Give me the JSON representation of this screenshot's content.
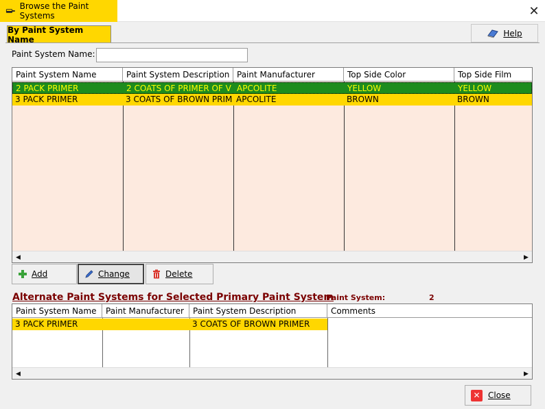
{
  "window": {
    "title": "Browse the Paint Systems",
    "close_glyph": "✕"
  },
  "tab": {
    "label": "By Paint System Name"
  },
  "help": {
    "label": "Help"
  },
  "search": {
    "label": "Paint System Name:",
    "value": "",
    "placeholder": ""
  },
  "main_grid": {
    "columns": [
      "Paint System Name",
      "Paint System Description",
      "Paint Manufacturer",
      "Top Side Color",
      "Top Side Film"
    ],
    "rows": [
      [
        "2 PACK PRIMER",
        "2 COATS OF PRIMER OF V",
        "APCOLITE",
        "YELLOW",
        "YELLOW"
      ],
      [
        "3 PACK PRIMER",
        "3 COATS OF BROWN PRIM",
        "APCOLITE",
        "BROWN",
        "BROWN"
      ]
    ],
    "selected_row": 0
  },
  "actions": {
    "add": "Add",
    "change": "Change",
    "delete": "Delete"
  },
  "alternate": {
    "title": "Alternate Paint Systems for Selected Primary Paint System",
    "ps_label": "Paint System:",
    "ps_value": "2",
    "columns": [
      "Paint System Name",
      "Paint Manufacturer",
      "Paint System Description",
      "Comments"
    ],
    "rows": [
      [
        "3 PACK PRIMER",
        "",
        "3 COATS OF BROWN PRIMER",
        ""
      ]
    ]
  },
  "close_button": {
    "label": "Close"
  },
  "colors": {
    "accent_yellow": "#ffd700",
    "selected_green": "#1e8c1e",
    "selected_text": "#ffff00",
    "grid_bg": "#fdeadf",
    "alt_title": "#7a0000"
  },
  "icons": {
    "app": "paint-brush-icon",
    "help": "book-icon",
    "add": "plus-icon",
    "change": "pencil-icon",
    "delete": "trash-icon",
    "close": "red-x-icon"
  }
}
